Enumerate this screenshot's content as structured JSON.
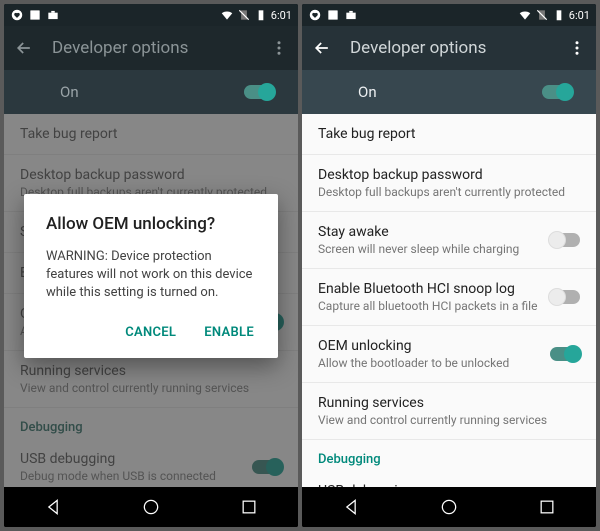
{
  "status": {
    "time": "6:01"
  },
  "appbar": {
    "title": "Developer options"
  },
  "master": {
    "label": "On"
  },
  "items": {
    "bug": {
      "title": "Take bug report"
    },
    "backup": {
      "title": "Desktop backup password",
      "sub": "Desktop full backups aren't currently protected"
    },
    "stay": {
      "title": "Stay awake",
      "sub": "Screen will never sleep while charging"
    },
    "hci": {
      "title": "Enable Bluetooth HCI snoop log",
      "sub": "Capture all bluetooth HCI packets in a file"
    },
    "oem": {
      "title": "OEM unlocking",
      "sub": "Allow the bootloader to be unlocked"
    },
    "running": {
      "title": "Running services",
      "sub": "View and control currently running services"
    },
    "usb": {
      "title": "USB debugging",
      "sub": "Debug mode when USB is connected"
    }
  },
  "section": {
    "debug": "Debugging"
  },
  "dialog": {
    "title": "Allow OEM unlocking?",
    "body": "WARNING: Device protection features will not work on this device while this setting is turned on.",
    "cancel": "CANCEL",
    "enable": "ENABLE"
  },
  "left_peek": {
    "s_title": "S",
    "e_title": "E",
    "oem_partial": "O"
  }
}
